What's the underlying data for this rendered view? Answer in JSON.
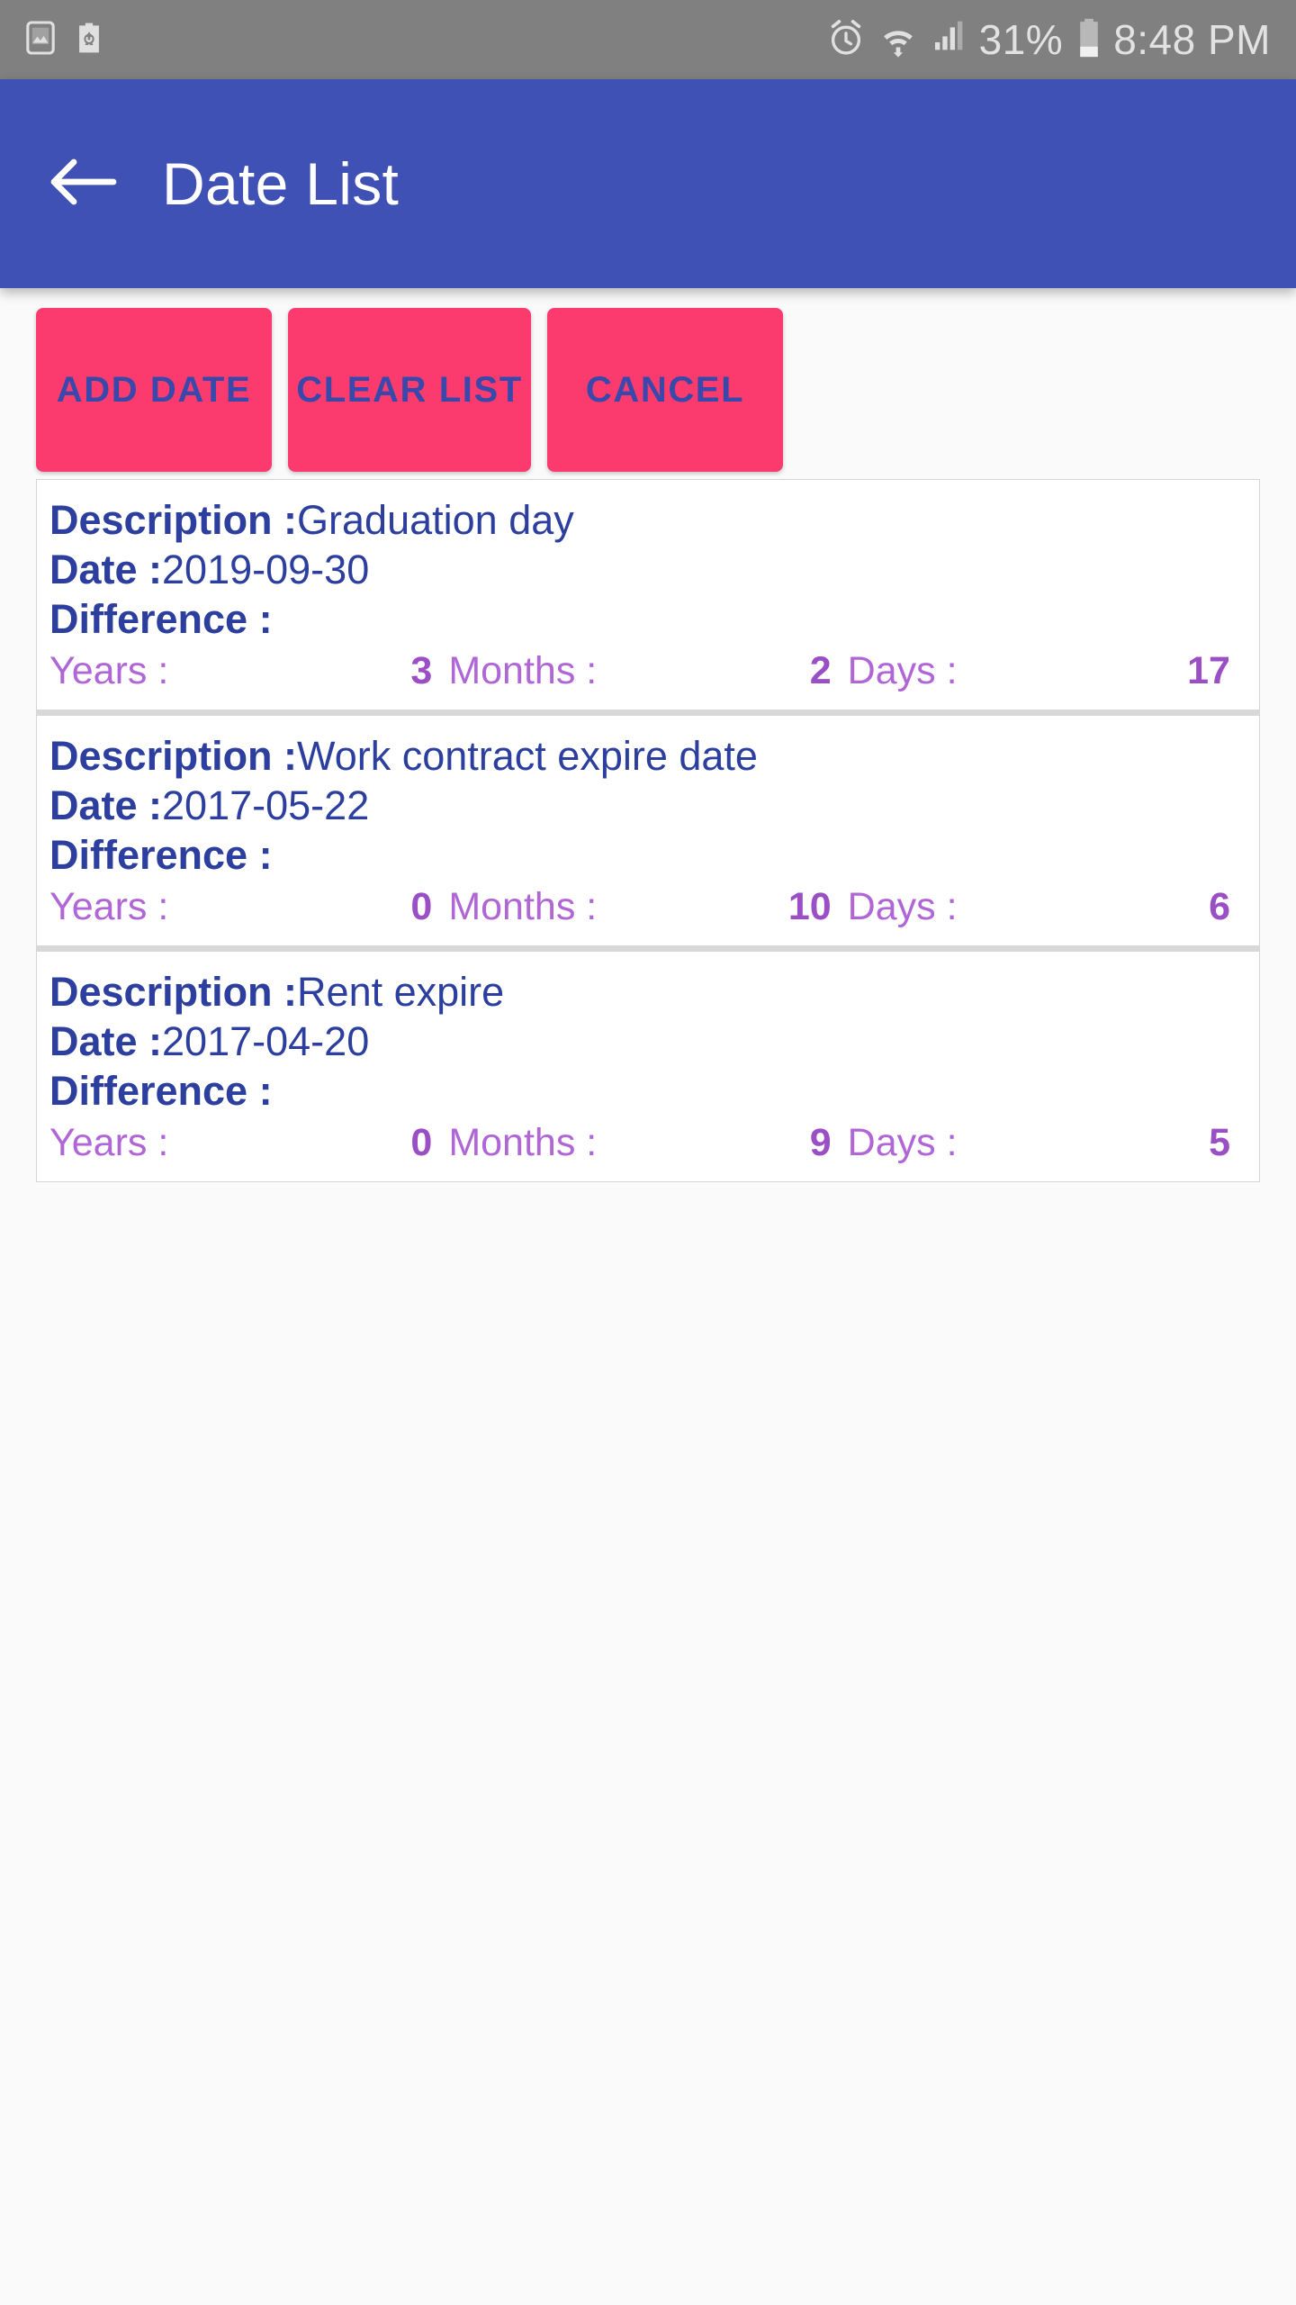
{
  "status_bar": {
    "left_icons": [
      "screenshot-image-icon",
      "recycle-clipboard-icon"
    ],
    "right_icons": [
      "alarm-clock-icon",
      "wifi-icon",
      "cellular-signal-icon",
      "battery-icon"
    ],
    "battery_percent": "31%",
    "time": "8:48 PM"
  },
  "app_bar": {
    "back_icon": "back-arrow-icon",
    "title": "Date List",
    "background_color": "#3f51b5"
  },
  "toolbar": {
    "add_date_label": "ADD DATE",
    "clear_list_label": "CLEAR LIST",
    "cancel_label": "CANCEL",
    "button_color": "#fb3b6e",
    "button_text_color": "#3949ab"
  },
  "labels": {
    "description": "Description :",
    "date": "Date :",
    "difference": "Difference :",
    "years": "Years :",
    "months": "Months :",
    "days": "Days :"
  },
  "colors": {
    "field_text": "#2c3e9e",
    "diff_label": "#b066d6",
    "diff_value": "#9b4fc4"
  },
  "entries": [
    {
      "description": "Graduation day",
      "date": "2019-09-30",
      "years": "3",
      "months": "2",
      "days": "17"
    },
    {
      "description": "Work contract expire date",
      "date": "2017-05-22",
      "years": "0",
      "months": "10",
      "days": "6"
    },
    {
      "description": "Rent expire",
      "date": "2017-04-20",
      "years": "0",
      "months": "9",
      "days": "5"
    }
  ]
}
